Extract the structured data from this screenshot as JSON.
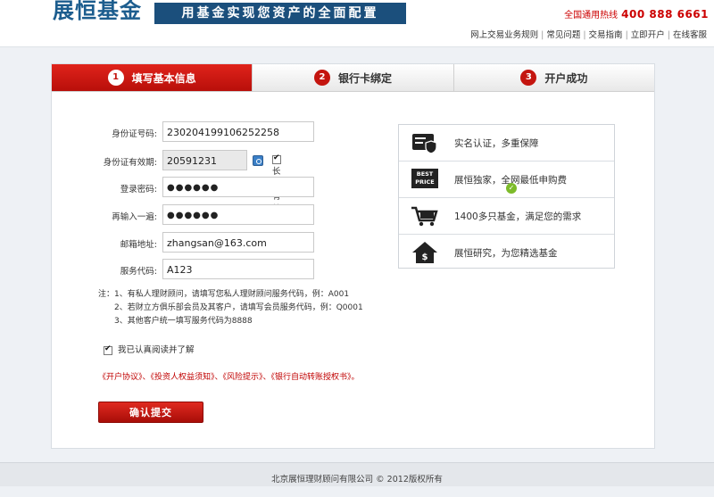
{
  "header": {
    "logo": "展恒基金",
    "slogan": "用基金实现您资产的全面配置",
    "hotline_label": "全国通用热线",
    "hotline_number": "400 888 6661",
    "links": [
      "网上交易业务规则",
      "常见问题",
      "交易指南",
      "立即开户",
      "在线客服"
    ]
  },
  "steps": [
    {
      "num": "1",
      "label": "填写基本信息"
    },
    {
      "num": "2",
      "label": "银行卡绑定"
    },
    {
      "num": "3",
      "label": "开户成功"
    }
  ],
  "form": {
    "id_label": "身份证号码:",
    "id_value": "230204199106252258",
    "validity_label": "身份证有效期:",
    "validity_value": "20591231",
    "long_valid_label": "长期有效",
    "password_label": "登录密码:",
    "password_value": "●●●●●●",
    "confirm_label": "再输入一遍:",
    "confirm_value": "●●●●●●",
    "email_label": "邮箱地址:",
    "email_value": "zhangsan@163.com",
    "service_label": "服务代码:",
    "service_value": "A123"
  },
  "features": [
    {
      "icon": "id-card-shield-icon",
      "text": "实名认证，多重保障"
    },
    {
      "icon": "best-price-icon",
      "text": "展恒独家，全网最低申购费"
    },
    {
      "icon": "shopping-cart-icon",
      "text": "1400多只基金，满足您的需求"
    },
    {
      "icon": "house-money-icon",
      "text": "展恒研究，为您精选基金"
    }
  ],
  "notes": {
    "line1": "注：1、有私人理财顾问，请填写您私人理财顾问服务代码，例：A001",
    "line2": "2、若财立方俱乐部会员及其客户，请填写会员服务代码，例：Q0001",
    "line3": "3、其他客户统一填写服务代码为8888"
  },
  "agree_label": "我已认真阅读并了解",
  "protocols": "《开户协议》、《投资人权益须知》、《风险提示》、《银行自动转账授权书》。",
  "submit_label": "确认提交",
  "footer": "北京展恒理财顾问有限公司 © 2012版权所有"
}
